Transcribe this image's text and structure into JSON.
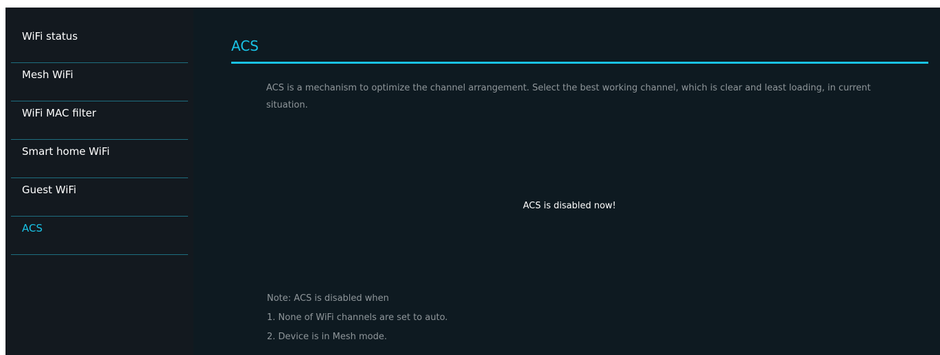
{
  "sidebar": {
    "items": [
      {
        "label": "WiFi status",
        "active": false
      },
      {
        "label": "Mesh WiFi",
        "active": false
      },
      {
        "label": "WiFi MAC filter",
        "active": false
      },
      {
        "label": "Smart home WiFi",
        "active": false
      },
      {
        "label": "Guest WiFi",
        "active": false
      },
      {
        "label": "ACS",
        "active": true
      }
    ]
  },
  "main": {
    "title": "ACS",
    "description": "ACS is a mechanism to optimize the channel arrangement. Select the best working channel, which is clear and least loading, in current situation.",
    "status_message": "ACS is disabled now!",
    "notes": [
      "Note: ACS is disabled when",
      "1. None of WiFi channels are set to auto.",
      "2. Device is in Mesh mode."
    ]
  },
  "colors": {
    "accent": "#19c3e6",
    "sidebar_bg": "#13191f",
    "main_bg": "#0e1a21",
    "muted_text": "#8f969a"
  }
}
